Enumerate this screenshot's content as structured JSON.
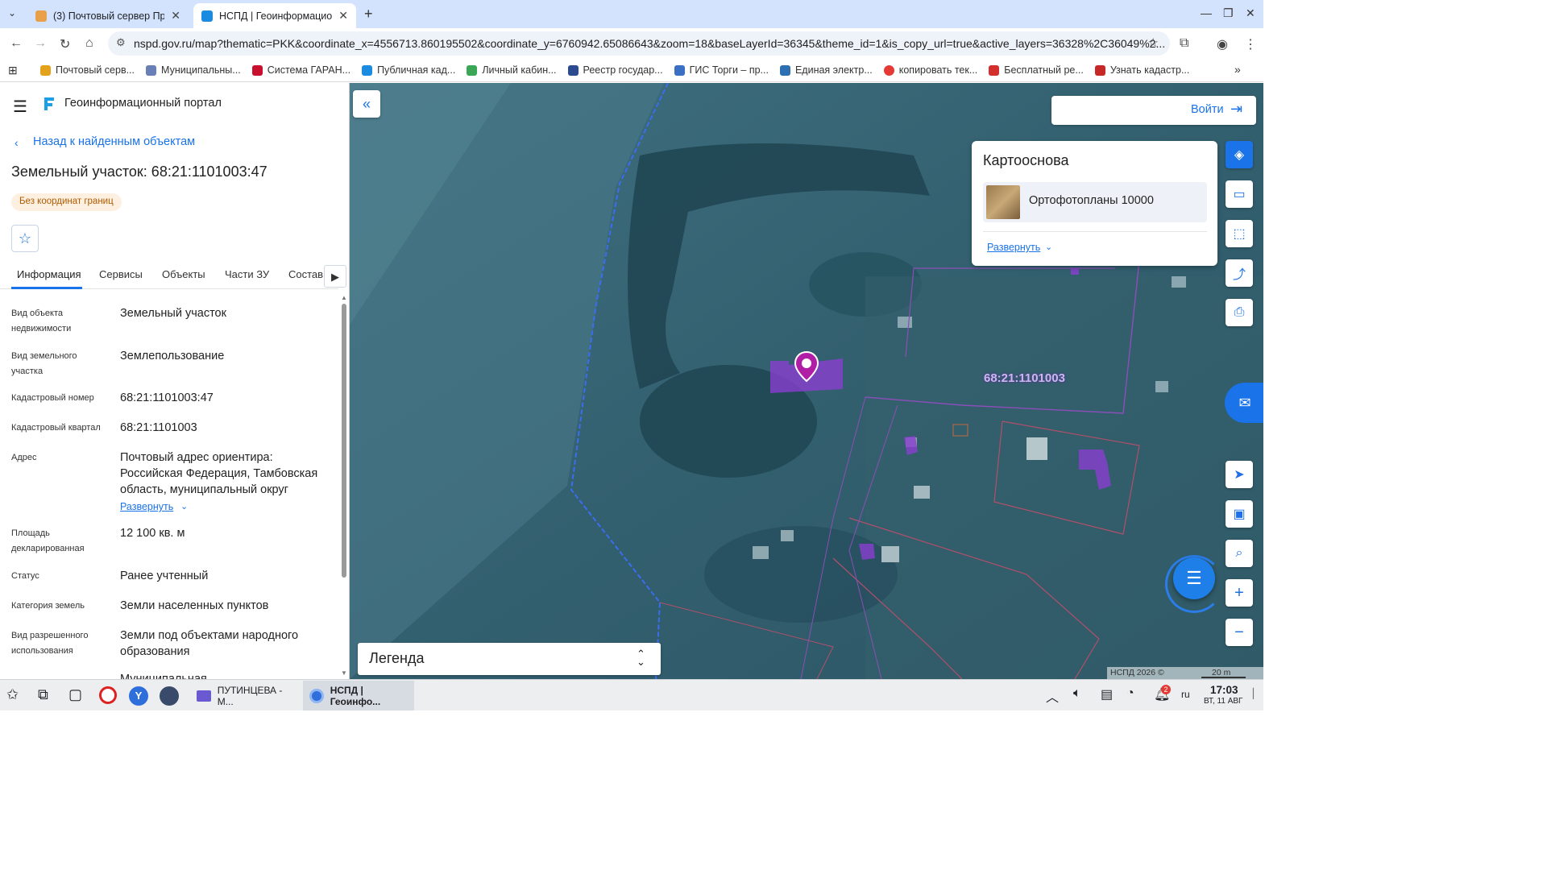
{
  "browser": {
    "tabs": [
      {
        "title": "(3) Почтовый сервер Пр",
        "active": false
      },
      {
        "title": "НСПД | Геоинформацио",
        "active": true
      }
    ],
    "url": "nspd.gov.ru/map?thematic=PKK&coordinate_x=4556713.860195502&coordinate_y=6760942.65086643&zoom=18&baseLayerId=36345&theme_id=1&is_copy_url=true&active_layers=36328%2C36049%2...",
    "bookmarks": [
      "Почтовый серв...",
      "Муниципальны...",
      "Система ГАРАН...",
      "Публичная кад...",
      "Личный кабин...",
      "Реестр государ...",
      "ГИС Торги – пр...",
      "Единая электр...",
      "копировать тек...",
      "Бесплатный ре...",
      "Узнать кадастр..."
    ]
  },
  "portal": {
    "title": "Геоинформационный портал",
    "back_link": "Назад к найденным объектам",
    "object_title": "Земельный участок: 68:21:1101003:47",
    "badge": "Без координат границ",
    "tabs": [
      "Информация",
      "Сервисы",
      "Объекты",
      "Части ЗУ",
      "Состав"
    ],
    "rows": [
      {
        "label": "Вид объекта недвижимости",
        "value": "Земельный участок"
      },
      {
        "label": "Вид земельного участка",
        "value": "Землепользование"
      },
      {
        "label": "Кадастровый номер",
        "value": "68:21:1101003:47"
      },
      {
        "label": "Кадастровый квартал",
        "value": "68:21:1101003"
      },
      {
        "label": "Адрес",
        "value": "Почтовый адрес ориентира: Российская Федерация, Тамбовская область, муниципальный округ"
      },
      {
        "label": "Площадь декларированная",
        "value": "12 100 кв. м"
      },
      {
        "label": "Статус",
        "value": "Ранее учтенный"
      },
      {
        "label": "Категория земель",
        "value": "Земли населенных пунктов"
      },
      {
        "label": "Вид разрешенного использования",
        "value": "Земли под объектами народного образования"
      }
    ],
    "expand_link": "Развернуть",
    "cut_value": "Муниципальная"
  },
  "map": {
    "login": "Войти",
    "basemap_title": "Картооснова",
    "basemap_item": "Ортофотопланы 10000",
    "basemap_expand": "Развернуть",
    "parcel_label": "68:21:1101003",
    "legend": "Легенда",
    "copyright": "НСПД 2026 ©",
    "scale": "20 m"
  },
  "taskbar": {
    "window1": "ПУТИНЦЕВА - М...",
    "window2": "НСПД | Геоинфо...",
    "lang": "ru",
    "time": "17:03",
    "date": "ВТ, 11 АВГ",
    "notif_count": "2"
  }
}
